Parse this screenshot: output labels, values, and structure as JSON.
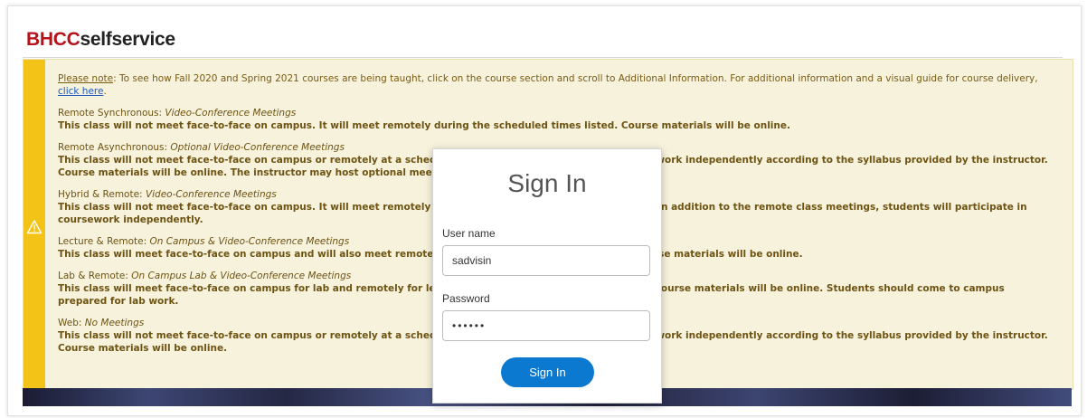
{
  "brand": {
    "part1": "BHCC",
    "part2": "selfservice"
  },
  "colors": {
    "brand_red": "#b5121b",
    "notice_bg": "#f6f2dc",
    "notice_bar": "#f3c417",
    "primary_button": "#0b79d0"
  },
  "notice": {
    "icon": "warning-icon",
    "please_note": "Please note",
    "intro_text": ": To see how Fall 2020 and Spring 2021 courses are being taught, click on the course section and scroll to Additional Information. For additional information and a visual guide for course delivery, ",
    "link_text": "click here",
    "period": ".",
    "items": [
      {
        "title": "Remote Synchronous: ",
        "subtitle": "Video-Conference Meetings",
        "description": "This class will not meet face-to-face on campus. It will meet remotely during the scheduled times listed. Course materials will be online."
      },
      {
        "title": "Remote Asynchronous: ",
        "subtitle": "Optional Video-Conference Meetings",
        "description": "This class will not meet face-to-face on campus or remotely at a scheduled time. Students will complete coursework independently according to the syllabus provided by the instructor. Course materials will be online. The instructor may host optional meetings during the times listed."
      },
      {
        "title": "Hybrid & Remote: ",
        "subtitle": "Video-Conference Meetings",
        "description": "This class will not meet face-to-face on campus. It will meet remotely online during the scheduled times listed. In addition to the remote class meetings, students will participate in coursework independently."
      },
      {
        "title": "Lecture & Remote: ",
        "subtitle": "On Campus & Video-Conference Meetings",
        "description": "This class will meet face-to-face on campus and will also meet remotely during the scheduled times listed. Course materials will be online."
      },
      {
        "title": "Lab & Remote: ",
        "subtitle": "On Campus Lab & Video-Conference Meetings",
        "description": "This class will meet face-to-face on campus for lab and remotely for lecture during the scheduled times listed. Course materials will be online. Students should come to campus prepared for lab work."
      },
      {
        "title": "Web: ",
        "subtitle": "No Meetings",
        "description": "This class will not meet face-to-face on campus or remotely at a scheduled time. Students will complete coursework independently according to the syllabus provided by the instructor. Course materials will be online."
      }
    ]
  },
  "signin": {
    "title": "Sign In",
    "username_label": "User name",
    "username_value": "sadvisin",
    "password_label": "Password",
    "password_value": "••••••",
    "button_label": "Sign In"
  }
}
